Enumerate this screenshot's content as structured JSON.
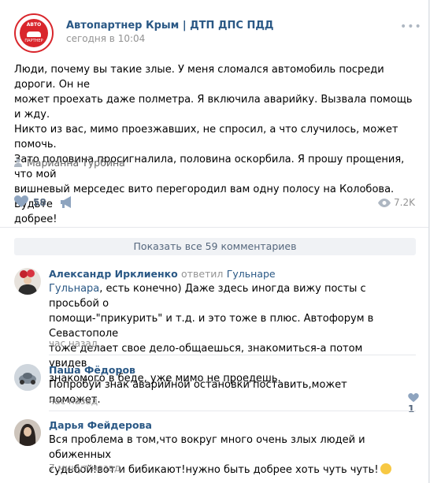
{
  "post": {
    "group_name": "Автопартнер Крым | ДТП ДПС ПДД",
    "date": "сегодня в 10:04",
    "logo": {
      "top": "АВТО",
      "bottom": "ПАРТНЕР",
      "color": "#d9262c"
    },
    "text": "Люди, почему вы такие злые. У меня сломался автомобиль посреди дороги. Он не\nможет проехать даже полметра. Я включила аварийку. Вызвала помощь и жду.\nНикто из вас, мимо проезжавших, не спросил, а что случилось, может помочь.\nЗато половина просигналила, половина оскорбила. Я прошу прощения, что мой\nвишневый мерседес вито перегородил вам одну полосу на Колобова. Будьте\nдобрее!",
    "author": "Марианна Турбина",
    "likes": "58",
    "views": "7.2K",
    "icons": {
      "more": "more-dots-icon",
      "like": "heart-icon",
      "share": "megaphone-icon",
      "views": "eye-icon",
      "author": "user-icon"
    }
  },
  "comments_section": {
    "show_all_label": "Показать все 59 комментариев",
    "comments": [
      {
        "name": "Александр Ирклиенко",
        "replied_word": "ответил",
        "replied_to": "Гульнаре",
        "reply_link": "Гульнара",
        "text": ", есть конечно) Даже здесь иногда вижу посты с просьбой о\nпомощи-\"прикурить\" и т.д. и это тоже в плюс. Автофорум в Севастополе\nтоже делает свое дело-общаешься, знакомиться-а потом увидев\nзнакомого в беде, уже мимо не проедешь.",
        "time": "час назад"
      },
      {
        "name": "Паша Фёдоров",
        "text": "Попробуй знак аварийной остановки поставить,может поможет.",
        "time": "час назад",
        "likes": "1"
      },
      {
        "name": "Дарья Фейдерова",
        "text": "Вся проблема в том,что вокруг много очень злых людей и обиженных\nсудьбой!вот и бибикают!нужно быть добрее хоть чуть чуть!",
        "time": "7 минут назад",
        "emoji": "grinning-face-emoji"
      }
    ]
  }
}
